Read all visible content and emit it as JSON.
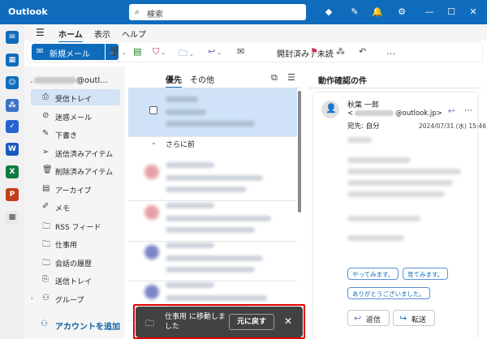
{
  "app": {
    "name": "Outlook"
  },
  "search": {
    "placeholder": "検索"
  },
  "ribbon": {
    "tabs": [
      {
        "label": "ホーム",
        "active": true
      },
      {
        "label": "表示",
        "active": false
      },
      {
        "label": "ヘルプ",
        "active": false
      }
    ]
  },
  "toolbar": {
    "new_mail_label": "新規メール",
    "mark_read_label": "開封済み / 未読",
    "more_label": "…"
  },
  "account": {
    "suffix": "@outl..."
  },
  "folders": [
    {
      "label": "受信トレイ",
      "icon": "inbox-icon",
      "selected": true
    },
    {
      "label": "迷惑メール",
      "icon": "junk-icon",
      "selected": false
    },
    {
      "label": "下書き",
      "icon": "pencil-icon",
      "selected": false
    },
    {
      "label": "送信済みアイテム",
      "icon": "send-icon",
      "selected": false
    },
    {
      "label": "削除済みアイテム",
      "icon": "trash-icon",
      "selected": false
    },
    {
      "label": "アーカイブ",
      "icon": "archive-icon",
      "selected": false
    },
    {
      "label": "メモ",
      "icon": "note-icon",
      "selected": false
    },
    {
      "label": "RSS フィード",
      "icon": "folder-icon",
      "selected": false
    },
    {
      "label": "仕事用",
      "icon": "folder-icon",
      "selected": false
    },
    {
      "label": "会話の履歴",
      "icon": "folder-icon",
      "selected": false
    },
    {
      "label": "送信トレイ",
      "icon": "outbox-icon",
      "selected": false
    },
    {
      "label": "グループ",
      "icon": "group-icon",
      "selected": false
    }
  ],
  "add_account_label": "アカウントを追加",
  "message_list": {
    "tabs": [
      {
        "label": "優先",
        "active": true
      },
      {
        "label": "その他",
        "active": false
      }
    ],
    "group_label": "さらに前"
  },
  "reading_pane": {
    "title": "動作確認の件",
    "sender_name": "秋葉 一郎",
    "email_prefix": "<",
    "email_suffix": "@outlook.jp>",
    "to": "宛先: 自分",
    "date": "2024/07/31 (水) 15:46",
    "suggested_replies": [
      "やってみます。",
      "見てみます。",
      "ありがとうございました。"
    ],
    "reply_label": "返信",
    "forward_label": "転送"
  },
  "toast": {
    "message": "仕事用 に移動しました",
    "undo_label": "元に戻す"
  },
  "colors": {
    "brand": "#0f6cbd",
    "selection": "#cfe2f7",
    "highlight": "#e00000"
  }
}
